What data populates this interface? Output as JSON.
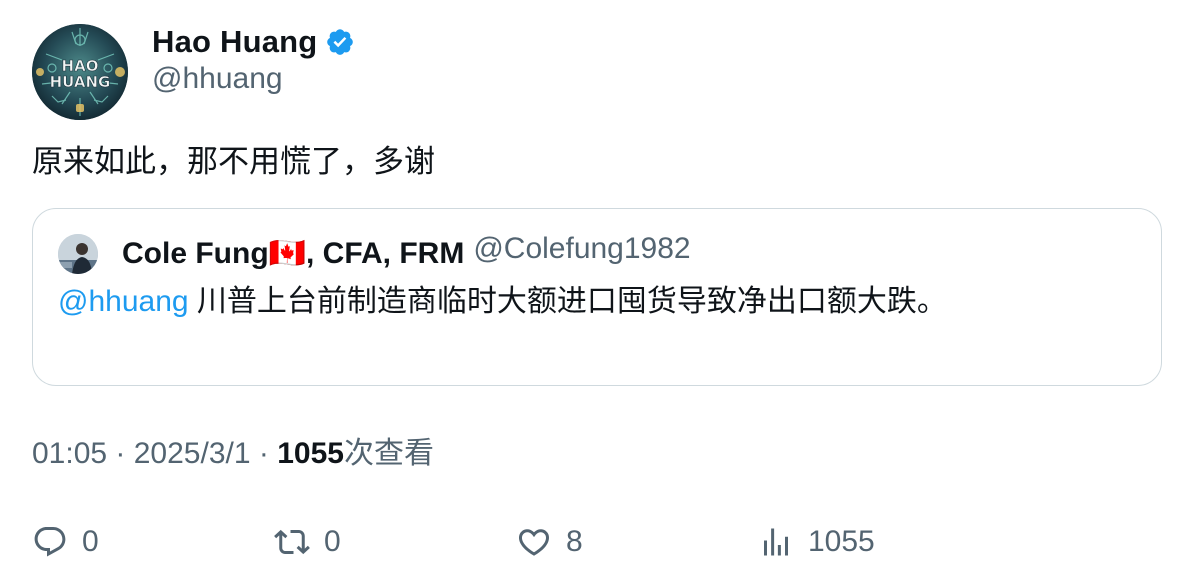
{
  "author": {
    "name": "Hao Huang",
    "handle": "@hhuang",
    "verified": true,
    "avatar_text_line1": "HAO",
    "avatar_text_line2": "HUANG"
  },
  "tweet": {
    "text": "原来如此，那不用慌了，多谢"
  },
  "quoted_tweet": {
    "author_name": "Cole Fung🇨🇦, CFA, FRM",
    "author_handle": "@Colefung1982",
    "mention": "@hhuang",
    "text": " 川普上台前制造商临时大额进口囤货导致净出口额大跌。"
  },
  "meta": {
    "time": "01:05",
    "separator1": " · ",
    "date": "2025/3/1",
    "separator2": " · ",
    "views_count": "1055",
    "views_label": "次查看"
  },
  "actions": {
    "reply_count": "0",
    "retweet_count": "0",
    "like_count": "8",
    "views_count": "1055"
  },
  "colors": {
    "text_primary": "#0f1419",
    "text_secondary": "#536471",
    "link": "#1d9bf0",
    "border": "#cfd9de",
    "verified_badge": "#1d9bf0"
  }
}
